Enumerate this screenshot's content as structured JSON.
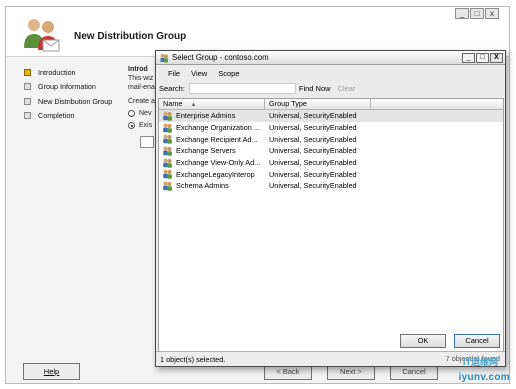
{
  "wizard": {
    "title": "New Distribution Group",
    "nav": [
      {
        "label": "Introduction",
        "active": true
      },
      {
        "label": "Group Information",
        "active": false
      },
      {
        "label": "New Distribution Group",
        "active": false
      },
      {
        "label": "Completion",
        "active": false
      }
    ],
    "intro_heading": "Introd",
    "intro_line1": "This wiz",
    "intro_line2": "mail-ena",
    "create_label": "Create a",
    "radio_new": "Nev",
    "radio_existing": "Exis",
    "help_label": "Help",
    "back_label": "< Back",
    "next_label": "Next >",
    "cancel_label": "Cancel",
    "titlebar_buttons": [
      "_",
      "□",
      "x"
    ]
  },
  "dialog": {
    "title": "Select Group - contoso.com",
    "menu": [
      "File",
      "View",
      "Scope"
    ],
    "search_label": "Search:",
    "search_value": "",
    "find_now_label": "Find Now",
    "clear_label": "Clear",
    "columns": [
      "Name",
      "Group Type"
    ],
    "sort_indicator": "▲",
    "rows": [
      {
        "name": "Enterprise Admins",
        "type": "Universal, SecurityEnabled",
        "selected": true
      },
      {
        "name": "Exchange Organization ...",
        "type": "Universal, SecurityEnabled",
        "selected": false
      },
      {
        "name": "Exchange Recipient Ad...",
        "type": "Universal, SecurityEnabled",
        "selected": false
      },
      {
        "name": "Exchange Servers",
        "type": "Universal, SecurityEnabled",
        "selected": false
      },
      {
        "name": "Exchange View-Only Ad...",
        "type": "Universal, SecurityEnabled",
        "selected": false
      },
      {
        "name": "ExchangeLegacyInterop",
        "type": "Universal, SecurityEnabled",
        "selected": false
      },
      {
        "name": "Schema Admins",
        "type": "Universal, SecurityEnabled",
        "selected": false
      }
    ],
    "ok_label": "OK",
    "cancel_label": "Cancel",
    "status_text": "1 object(s) selected.",
    "status_right": "7 object(s) found",
    "window_buttons": [
      "_",
      "□",
      "X"
    ]
  },
  "watermark": {
    "line1": "IT运维网",
    "line2": "iyunv.com"
  },
  "colors": {
    "active_step": "#e8b400",
    "dialog_bg": "#ebebeb",
    "selection": "#e4e4e4",
    "cancel_border": "#3b6fb6"
  }
}
